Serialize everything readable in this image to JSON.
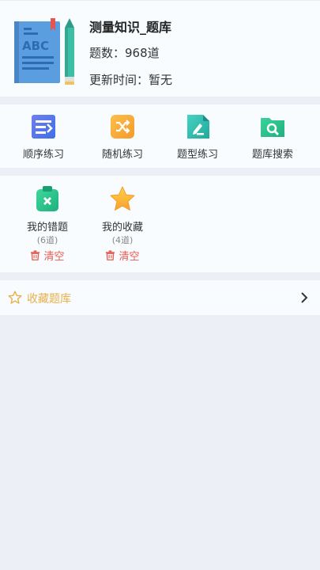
{
  "header": {
    "title": "测量知识_题库",
    "question_count": "题数：968道",
    "updated": "更新时间：暂无",
    "book_icon": "abc-book-with-pencil-icon"
  },
  "practice": {
    "items": [
      {
        "label": "顺序练习",
        "icon": "sequential-list-icon",
        "color": "#4f7cf0"
      },
      {
        "label": "随机练习",
        "icon": "shuffle-icon",
        "color": "#f6a43a"
      },
      {
        "label": "题型练习",
        "icon": "edit-document-icon",
        "color": "#33c2b3"
      },
      {
        "label": "题库搜索",
        "icon": "folder-search-icon",
        "color": "#26c08a"
      }
    ]
  },
  "mine": {
    "items": [
      {
        "label": "我的错题",
        "count": "(6道)",
        "clear": "清空",
        "icon": "clipboard-x-icon"
      },
      {
        "label": "我的收藏",
        "count": "(4道)",
        "clear": "清空",
        "icon": "star-icon"
      }
    ]
  },
  "favorites_row": {
    "label": "收藏题库",
    "icon": "star-outline-icon",
    "accent": "#e8b04a"
  },
  "colors": {
    "background": "#eceff5",
    "card": "#f8fcff",
    "danger": "#e65a50"
  }
}
